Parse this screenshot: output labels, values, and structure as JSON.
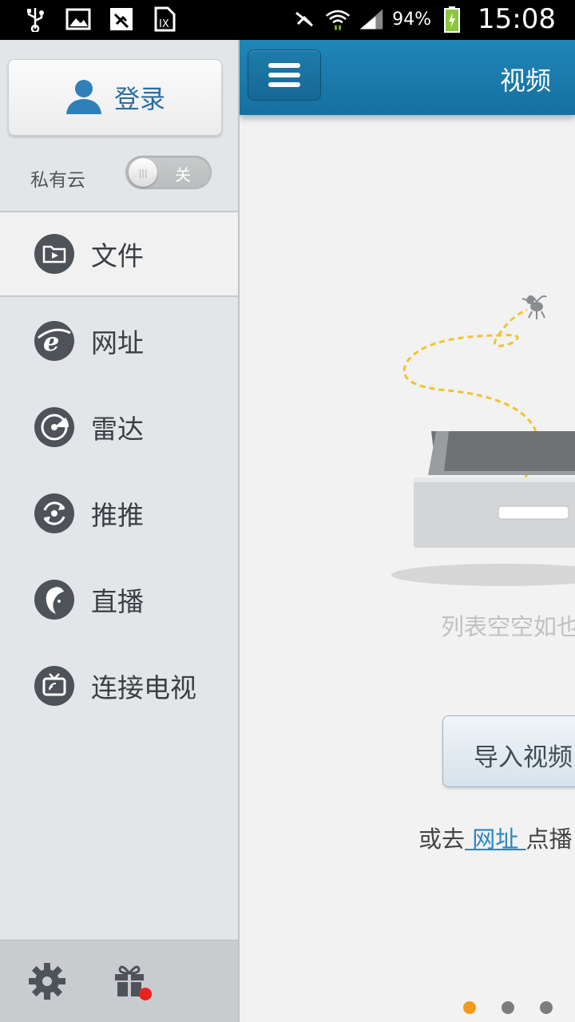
{
  "status_bar": {
    "battery_percent": "94%",
    "time": "15:08",
    "icons": [
      "usb-icon",
      "image-icon",
      "mute-notification-icon",
      "sim-icon",
      "vibrate-silent-icon",
      "wifi-icon",
      "signal-icon",
      "battery-charging-icon"
    ]
  },
  "drawer": {
    "login_label": "登录",
    "private_cloud_label": "私有云",
    "private_cloud_toggle": "关",
    "nav_items": [
      {
        "label": "文件",
        "icon": "folder-play-icon"
      },
      {
        "label": "网址",
        "icon": "browser-e-icon"
      },
      {
        "label": "雷达",
        "icon": "radar-icon"
      },
      {
        "label": "推推",
        "icon": "share-sync-icon"
      },
      {
        "label": "直播",
        "icon": "live-face-icon"
      },
      {
        "label": "连接电视",
        "icon": "tv-connect-icon"
      }
    ],
    "footer_icons": [
      "gear-icon",
      "gift-icon"
    ]
  },
  "main": {
    "title": "视频",
    "empty_text": "列表空空如也",
    "import_label": "导入视频",
    "goto_prefix": "或去",
    "goto_link": " 网址 ",
    "goto_suffix": "点播"
  },
  "colors": {
    "topbar": "#1a7aad",
    "drawer_bg": "#e3e6e8",
    "link": "#2a86c0",
    "dot_active": "#f39a1a"
  },
  "page_dots": {
    "count": 3,
    "active_index": 0
  }
}
